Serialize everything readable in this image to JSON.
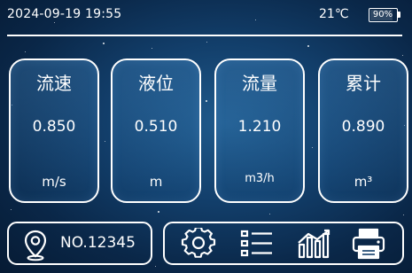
{
  "status_bar": {
    "datetime": "2024-09-19 19:55",
    "temperature": "21℃",
    "battery_label": "90%",
    "battery_level": 0.9
  },
  "cards": [
    {
      "title": "流速",
      "value": "0.850",
      "unit": "m/s"
    },
    {
      "title": "液位",
      "value": "0.510",
      "unit": "m"
    },
    {
      "title": "流量",
      "value": "1.210",
      "unit": "m3/h"
    },
    {
      "title": "累计",
      "value": "0.890",
      "unit": "m³"
    }
  ],
  "device": {
    "icon": "location-pin-icon",
    "id": "NO.12345"
  },
  "toolbar": {
    "icons": [
      "gear-icon",
      "list-icon",
      "bar-chart-icon",
      "printer-icon"
    ]
  },
  "colors": {
    "background": "#123e6a",
    "foreground": "#ffffff"
  }
}
